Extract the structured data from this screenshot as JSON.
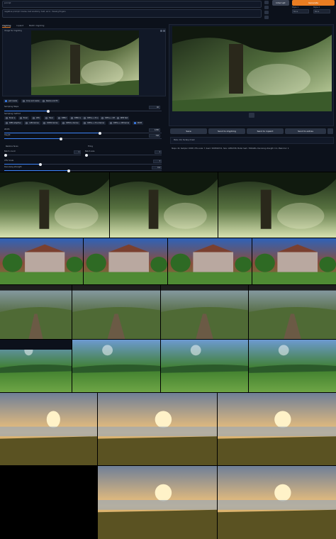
{
  "top": {
    "prompt1_label": "prompt",
    "prompt2_text": "negative prompt: lowres, bad anatomy, text, error, missing fingers",
    "interrupt_label": "Interrupt",
    "generate_label": "Generate",
    "style1_label": "Style 1",
    "style1_value": "None",
    "style2_label": "Style 2",
    "style2_value": "None"
  },
  "tabs": [
    "Img2img",
    "Inpaint",
    "Batch img2img"
  ],
  "source_panel": {
    "label": "Image for img2img"
  },
  "resize_modes": [
    {
      "label": "Just resize",
      "on": true
    },
    {
      "label": "Crop and resize",
      "on": false
    },
    {
      "label": "Resize and fill",
      "on": false
    }
  ],
  "sampling_steps": {
    "label": "Sampling Steps",
    "value": "40",
    "fraction": 0.27
  },
  "sampling_method": {
    "label": "Sampling method",
    "options": [
      "Euler a",
      "Euler",
      "LMS",
      "Heun",
      "DPM2",
      "DPM2 a",
      "DPM++ 2S a",
      "DPM++ 2M",
      "DPM fast",
      "DPM adaptive",
      "LMS Karras",
      "DPM2 Karras",
      "DPM2 a Karras",
      "DPM++ 2S a Karras",
      "DPM++ 2M Karras",
      "DDIM"
    ],
    "selected": "DDIM"
  },
  "width": {
    "label": "Width",
    "value": "1280",
    "fraction": 0.6
  },
  "height": {
    "label": "Height",
    "value": "768",
    "fraction": 0.35
  },
  "checks": [
    "Restore faces",
    "Tiling"
  ],
  "batch_count": {
    "label": "Batch count",
    "value": "1"
  },
  "batch_size": {
    "label": "Batch size",
    "value": "1"
  },
  "cfg": {
    "label": "CFG Scale",
    "value": "7",
    "fraction": 0.22
  },
  "denoise": {
    "label": "Denoising strength",
    "value": "0.4",
    "fraction": 0.4
  },
  "actions": [
    "Save",
    "Send to img2img",
    "Send to inpaint",
    "Send to extras"
  ],
  "output_info": {
    "prompt_line": "Meta. Old, fantasy forest",
    "params_line": "Steps: 40, Sampler: DDIM, CFG scale: 7, Seed: 3293826721, Size: 1280x768, Model hash: 7460a6fa, Denoising strength: 0.4, Mask blur: 4"
  },
  "colors": {
    "accent": "#ea7d22",
    "background": "#0c111b",
    "panel": "#111827",
    "slider": "#3b82f6"
  }
}
